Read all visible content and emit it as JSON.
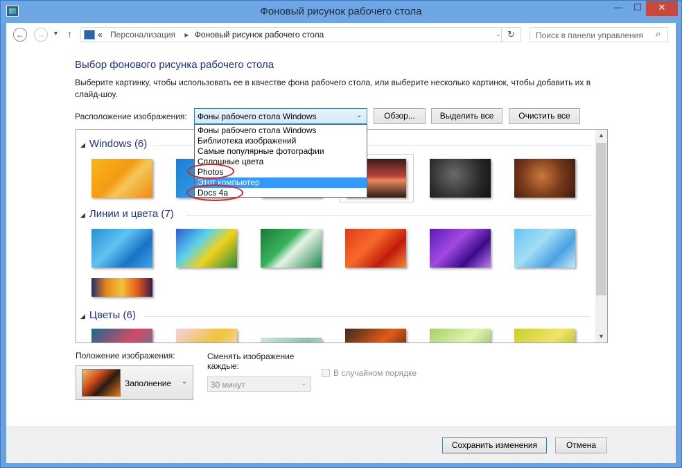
{
  "window": {
    "title": "Фоновый рисунок рабочего стола",
    "controls": {
      "minimize": "—",
      "maximize": "☐",
      "close": "✕"
    }
  },
  "nav": {
    "back_icon": "←",
    "forward_icon": "→",
    "dropdown_icon": "▼",
    "up_icon": "↑",
    "breadcrumb": {
      "prefix": "«",
      "items": [
        "Персонализация",
        "Фоновый рисунок рабочего стола"
      ],
      "separator": "▸"
    },
    "address_dropdown_icon": "⌄",
    "refresh_icon": "↻",
    "search_placeholder": "Поиск в панели управления",
    "search_icon": "⌕"
  },
  "main": {
    "heading": "Выбор фонового рисунка рабочего стола",
    "description": "Выберите картинку, чтобы использовать ее в качестве фона рабочего стола, или выберите несколько картинок, чтобы добавить их в слайд-шоу.",
    "location_label": "Расположение изображения:",
    "location_value": "Фоны рабочего стола Windows",
    "select_arrow": "⌄",
    "browse_button": "Обзор...",
    "select_all_button": "Выделить все",
    "clear_all_button": "Очистить все",
    "dropdown_options": [
      "Фоны рабочего стола Windows",
      "Библиотека изображений",
      "Самые популярные фотографии",
      "Сплошные цвета",
      "Photos",
      "Этот компьютер",
      "Docs 4a"
    ],
    "dropdown_selected_index": 5
  },
  "gallery": {
    "groups": [
      {
        "title": "Windows (6)",
        "thumbs": [
          "linear-gradient(135deg,#f7b51c 0%,#f59b12 45%,#f3c75a 60%,#f08a0e 100%)",
          "linear-gradient(135deg,#1a7fd4,#3fb1ee)",
          "linear-gradient(180deg,#2a1820,#5a2a38)",
          "linear-gradient(180deg,#3a1a18 0%,#b8433a 45%,#e88a5a 55%,#2a1a18 100%)",
          "radial-gradient(circle at 40% 40%,#6a6a6a,#2b2b2b 60%,#111)",
          "radial-gradient(circle at 45% 45%,#c97a3a,#7a3a1c 50%,#3a1a0c)"
        ]
      },
      {
        "title": "Линии и цвета (7)",
        "thumbs": [
          "linear-gradient(135deg,#2a8fd6,#5fc2f2 40%,#1a73c4 70%,#39a8e8)",
          "linear-gradient(135deg,#2a5cd4,#5bd1e8 35%,#f2d21c 60%,#2a8a3a)",
          "linear-gradient(135deg,#1a7a3a,#39b25a 40%,#e8f2e8 55%,#1a8a4a)",
          "linear-gradient(135deg,#e23a1a,#f76a2a 40%,#c21a0a 70%,#f08a3a)",
          "linear-gradient(135deg,#5a1ab2,#a24ae2 40%,#3a0a8a 70%,#c27af2)",
          "linear-gradient(135deg,#6ac2f2,#a2ddf5 40%,#4aa2e2 70%,#c2e8f8)",
          "linear-gradient(90deg,#2a2a6a,#e88a1a 25%,#f2c23a 50%,#e85a1a 75%,#3a1a4a)"
        ]
      },
      {
        "title": "Цветы (6)",
        "thumbs": [
          "linear-gradient(135deg,#1a6a8a,#d24a6a 50%,#2a8aa2)",
          "linear-gradient(135deg,#f2d2e2,#f2c23a 50%,#f8e2ea)",
          "linear-gradient(135deg,#cfe8df,#8ac2b2 50%,#e8f2ef)",
          "linear-gradient(135deg,#3a2a1a,#e25a1a 50%,#2a1a0a)",
          "linear-gradient(135deg,#a2d26a,#e2f2b2 50%,#6ab23a)",
          "linear-gradient(135deg,#c2d22a,#f2e26a 50%,#8ab21a)"
        ]
      }
    ],
    "group_arrow": "◢",
    "scroll_up": "▲",
    "scroll_down": "▼"
  },
  "options": {
    "position_label": "Положение изображения:",
    "position_value": "Заполнение",
    "position_arrow": "⌄",
    "change_label": "Сменять изображение каждые:",
    "interval_value": "30 минут",
    "interval_arrow": "⌄",
    "shuffle_label": "В случайном порядке"
  },
  "footer": {
    "save_button": "Сохранить изменения",
    "cancel_button": "Отмена"
  },
  "colors": {
    "accent": "#3399ff",
    "heading": "#1e3287",
    "annotation": "#d0252a"
  }
}
